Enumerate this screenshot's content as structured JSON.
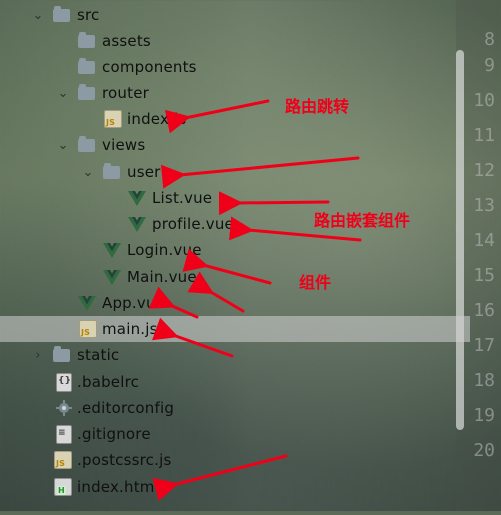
{
  "file_tree": [
    {
      "label": "src",
      "icon": "folder-icon",
      "indent": 0,
      "expanded": true
    },
    {
      "label": "assets",
      "icon": "folder-icon",
      "indent": 1
    },
    {
      "label": "components",
      "icon": "folder-icon",
      "indent": 1
    },
    {
      "label": "router",
      "icon": "folder-icon",
      "indent": 1,
      "expanded": true
    },
    {
      "label": "index.js",
      "icon": "js-file-icon",
      "indent": 2
    },
    {
      "label": "views",
      "icon": "folder-icon",
      "indent": 1,
      "expanded": true
    },
    {
      "label": "user",
      "icon": "folder-icon",
      "indent": 2,
      "expanded": true
    },
    {
      "label": "List.vue",
      "icon": "vue-file-icon",
      "indent": 3
    },
    {
      "label": "profile.vue",
      "icon": "vue-file-icon",
      "indent": 3
    },
    {
      "label": "Login.vue",
      "icon": "vue-file-icon",
      "indent": 2
    },
    {
      "label": "Main.vue",
      "icon": "vue-file-icon",
      "indent": 2
    },
    {
      "label": "App.vue",
      "icon": "vue-file-icon",
      "indent": 1
    },
    {
      "label": "main.js",
      "icon": "js-file-icon",
      "indent": 1,
      "selected": true
    },
    {
      "label": "static",
      "icon": "folder-icon",
      "indent": 0,
      "expanded": false
    },
    {
      "label": ".babelrc",
      "icon": "json-file-icon",
      "indent": 0
    },
    {
      "label": ".editorconfig",
      "icon": "gear-icon",
      "indent": 0
    },
    {
      "label": ".gitignore",
      "icon": "text-file-icon",
      "indent": 0
    },
    {
      "label": ".postcssrc.js",
      "icon": "js-file-icon",
      "indent": 0
    },
    {
      "label": "index.html",
      "icon": "html-file-icon",
      "indent": 0
    }
  ],
  "line_numbers": [
    "8",
    "9",
    "10",
    "11",
    "12",
    "13",
    "14",
    "15",
    "16",
    "17",
    "18",
    "19",
    "20"
  ],
  "annotations": {
    "router_label": "路由跳转",
    "nested_label": "路由嵌套组件",
    "component_label": "组件",
    "color": "#f00018"
  },
  "colors": {
    "folder": "#8b9aa3",
    "vue_green": "#2f6b3f",
    "selected_row": "#d2d2d2"
  }
}
